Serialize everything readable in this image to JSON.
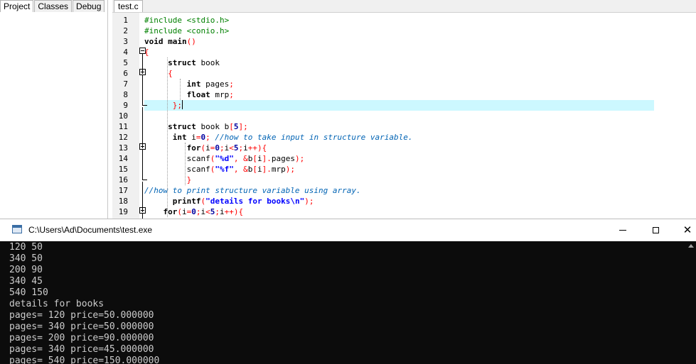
{
  "sidebar": {
    "tabs": [
      "Project",
      "Classes",
      "Debug"
    ]
  },
  "editor": {
    "file_tab": "test.c",
    "lines": [
      {
        "n": "1",
        "code": "<span class=\"pp\">#include &lt;stdio.h&gt;</span>"
      },
      {
        "n": "2",
        "code": "<span class=\"pp\">#include &lt;conio.h&gt;</span>"
      },
      {
        "n": "3",
        "code": "<span class=\"kw\">void</span> <span class=\"fn\">main</span><span class=\"punc\">()</span>"
      },
      {
        "n": "4",
        "code": "<span class=\"punc\">{</span>"
      },
      {
        "n": "5",
        "code": "     <span class=\"kw\">struct</span> book"
      },
      {
        "n": "6",
        "code": "     <span class=\"punc\">{</span>"
      },
      {
        "n": "7",
        "code": "         <span class=\"kw\">int</span> pages<span class=\"punc\">;</span>"
      },
      {
        "n": "8",
        "code": "         <span class=\"kw\">float</span> mrp<span class=\"punc\">;</span>"
      },
      {
        "n": "9",
        "code": "      <span class=\"punc\">};</span><span class=\"caret\"></span>"
      },
      {
        "n": "10",
        "code": ""
      },
      {
        "n": "11",
        "code": "     <span class=\"kw\">struct</span> book b<span class=\"punc\">[</span><span class=\"num\">5</span><span class=\"punc\">];</span>"
      },
      {
        "n": "12",
        "code": "      <span class=\"kw\">int</span> i<span class=\"punc\">=</span><span class=\"num\">0</span><span class=\"punc\">;</span> <span class=\"cmt\">//how to take input in structure variable.</span>"
      },
      {
        "n": "13",
        "code": "         <span class=\"kw\">for</span><span class=\"punc\">(</span>i<span class=\"punc\">=</span><span class=\"num\">0</span><span class=\"punc\">;</span>i<span class=\"punc\">&lt;</span><span class=\"num\">5</span><span class=\"punc\">;</span>i<span class=\"punc\">++){</span>"
      },
      {
        "n": "14",
        "code": "         scanf<span class=\"punc\">(</span><span class=\"str\">\"%d\"</span><span class=\"punc\">,</span> <span class=\"punc\">&amp;</span>b<span class=\"punc\">[</span>i<span class=\"punc\">].</span>pages<span class=\"punc\">);</span>"
      },
      {
        "n": "15",
        "code": "         scanf<span class=\"punc\">(</span><span class=\"str\">\"%f\"</span><span class=\"punc\">,</span> <span class=\"punc\">&amp;</span>b<span class=\"punc\">[</span>i<span class=\"punc\">].</span>mrp<span class=\"punc\">);</span>"
      },
      {
        "n": "16",
        "code": "         <span class=\"punc\">}</span>"
      },
      {
        "n": "17",
        "code": "<span class=\"cmt\">//how to print structure variable using array.</span>"
      },
      {
        "n": "18",
        "code": "      <span class=\"fn\">printf</span><span class=\"punc\">(</span><span class=\"str\">\"details for books\\n\"</span><span class=\"punc\">);</span>"
      },
      {
        "n": "19",
        "code": "    <span class=\"kw\">for</span><span class=\"punc\">(</span>i<span class=\"punc\">=</span><span class=\"num\">0</span><span class=\"punc\">;</span>i<span class=\"punc\">&lt;</span><span class=\"num\">5</span><span class=\"punc\">;</span>i<span class=\"punc\">++){</span>"
      }
    ]
  },
  "console": {
    "title": "C:\\Users\\Ad\\Documents\\test.exe",
    "output": [
      "120 50",
      "340 50",
      "200 90",
      "340 45",
      "540 150",
      "details for books",
      "pages= 120 price=50.000000",
      "pages= 340 price=50.000000",
      "pages= 200 price=90.000000",
      "pages= 340 price=45.000000",
      "pages= 540 price=150.000000"
    ]
  }
}
